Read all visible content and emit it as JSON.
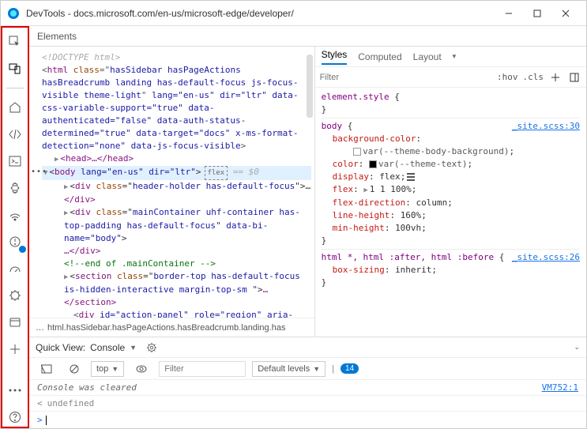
{
  "window": {
    "title": "DevTools - docs.microsoft.com/en-us/microsoft-edge/developer/"
  },
  "elements_tab": "Elements",
  "dom": {
    "doctype": "<!DOCTYPE html>",
    "html_open": "html",
    "html_class": "hasSidebar hasPageActions hasBreadcrumb landing has-default-focus js-focus-visible theme-light",
    "html_attrs_rest": " lang=\"en-us\" dir=\"ltr\" data-css-variable-support=\"true\" data-authenticated=\"false\" data-auth-status-determined=\"true\" data-target=\"docs\" x-ms-format-detection=\"none\" data-js-focus-visible",
    "head": "<head>…</head>",
    "body_open": "body",
    "body_attrs": " lang=\"en-us\" dir=\"ltr\"",
    "body_flex": "flex",
    "body_eq": "== $0",
    "div1_open": "div",
    "div1_class": "header-holder has-default-focus",
    "div1_close": "</div>",
    "div2_open": "div",
    "div2_class": "mainContainer  uhf-container has-top-padding  has-default-focus",
    "div2_extra": " data-bi-name=\"body\"",
    "div2_close": "…</div>",
    "cmt": "<!--end of .mainContainer -->",
    "section_open": "section",
    "section_class": "border-top has-default-focus is-hidden-interactive margin-top-sm ",
    "section_close": "…</section>",
    "div3": "div",
    "div3_attrs": " id=\"action-panel\" role=\"region\" aria-label="
  },
  "breadcrumb": {
    "dots": "…",
    "path": "html.hasSidebar.hasPageActions.hasBreadcrumb.landing.has"
  },
  "styles": {
    "tabs": {
      "styles": "Styles",
      "computed": "Computed",
      "layout": "Layout"
    },
    "filter_ph": "Filter",
    "hov": ":hov",
    "cls": ".cls",
    "rule1": {
      "sel": "element.style",
      "body": "}"
    },
    "rule2": {
      "sel": "body",
      "link": "_site.scss:30",
      "p1": "background-color",
      "v1": "var(--theme-body-background)",
      "p2": "color",
      "v2": "var(--theme-text)",
      "p3": "display",
      "v3": "flex",
      "p4": "flex",
      "v4": "1 1 100%",
      "p5": "flex-direction",
      "v5": "column",
      "p6": "line-height",
      "v6": "160%",
      "p7": "min-height",
      "v7": "100vh"
    },
    "rule3": {
      "sel": "html *, html :after, html :before",
      "link": "_site.scss:26",
      "p1": "box-sizing",
      "v1": "inherit"
    }
  },
  "quickview": {
    "label": "Quick View:",
    "panel": "Console"
  },
  "console": {
    "top": "top",
    "filter_ph": "Filter",
    "levels": "Default levels",
    "issues": "14",
    "msg1": "Console was cleared",
    "src1": "VM752:1",
    "msg2": "undefined"
  }
}
